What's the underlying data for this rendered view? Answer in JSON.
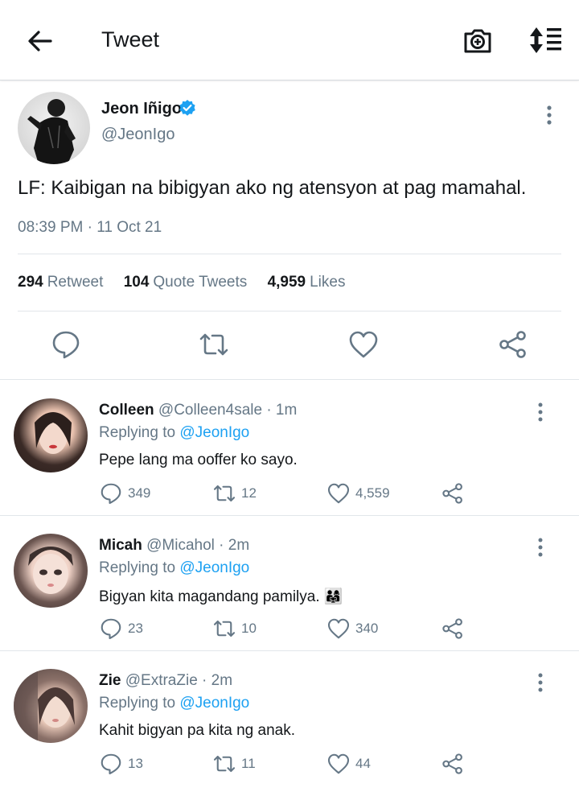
{
  "header": {
    "title": "Tweet"
  },
  "tweet": {
    "author_name": "Jeon Iñigo",
    "author_handle": "@JeonIgo",
    "text": "LF: Kaibigan na bibigyan ako ng atensyon at pag mamahal.",
    "time": "08:39 PM · 11 Oct 21",
    "stats": {
      "retweets": "294",
      "retweets_label": "Retweet",
      "quotes": "104",
      "quotes_label": "Quote Tweets",
      "likes": "4,959",
      "likes_label": "Likes"
    }
  },
  "replies": [
    {
      "name": "Colleen",
      "handle_time": "@Colleen4sale · 1m",
      "replying_label": "Replying to",
      "replying_to": "@JeonIgo",
      "text": "Pepe lang ma ooffer ko sayo.",
      "replies": "349",
      "retweets": "12",
      "likes": "4,559"
    },
    {
      "name": "Micah",
      "handle_time": "@Micahol · 2m",
      "replying_label": "Replying to",
      "replying_to": "@JeonIgo",
      "text": "Bigyan kita magandang pamilya. 👨‍👩‍👧",
      "replies": "23",
      "retweets": "10",
      "likes": "340"
    },
    {
      "name": "Zie",
      "handle_time": "@ExtraZie · 2m",
      "replying_label": "Replying to",
      "replying_to": "@JeonIgo",
      "text": "Kahit bigyan pa kita ng anak.",
      "replies": "13",
      "retweets": "11",
      "likes": "44"
    }
  ],
  "colors": {
    "accent": "#1da1f2",
    "muted": "#657786",
    "text": "#14171a",
    "icon": "#657786"
  },
  "icons": [
    "back-arrow-icon",
    "camera-icon",
    "sort-icon",
    "verified-icon",
    "more-vertical-icon",
    "reply-icon",
    "retweet-icon",
    "like-icon",
    "share-icon"
  ]
}
